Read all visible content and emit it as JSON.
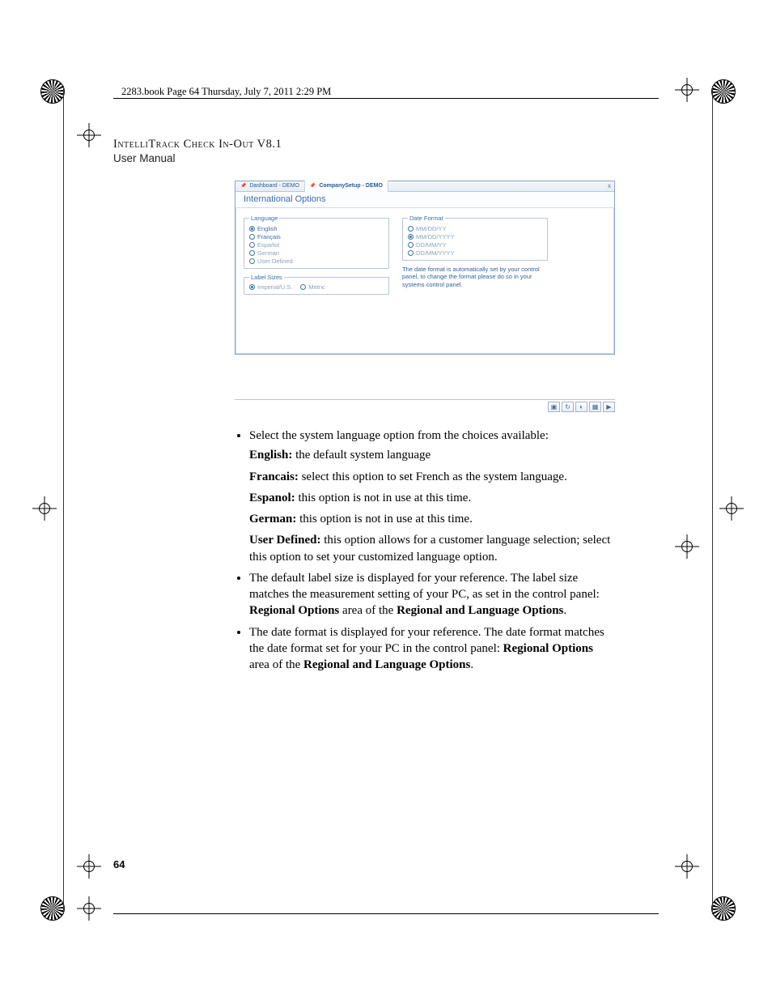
{
  "top_rule_text": "2283.book  Page 64  Thursday, July 7, 2011  2:29 PM",
  "header": {
    "title": "IntelliTrack Check In-Out V8.1",
    "subtitle": "User Manual"
  },
  "screenshot": {
    "tabs": [
      {
        "label": "Dashboard - DEMO",
        "active": false
      },
      {
        "label": "CompanySetup - DEMO",
        "active": true
      }
    ],
    "close_x": "x",
    "window_title": "International Options",
    "language": {
      "legend": "Language",
      "options": [
        {
          "label": "English",
          "selected": true,
          "dim": false
        },
        {
          "label": "Français",
          "selected": false,
          "dim": false
        },
        {
          "label": "Español",
          "selected": false,
          "dim": true
        },
        {
          "label": "German",
          "selected": false,
          "dim": true
        },
        {
          "label": "User Defined",
          "selected": false,
          "dim": true
        }
      ]
    },
    "label_sizes": {
      "legend": "Label Sizes",
      "options": [
        {
          "label": "Imperial/U.S.",
          "selected": true,
          "dim": true
        },
        {
          "label": "Metric",
          "selected": false,
          "dim": true
        }
      ]
    },
    "date_format": {
      "legend": "Date Format",
      "options": [
        {
          "label": "MM/DD/YY",
          "selected": false,
          "dim": true
        },
        {
          "label": "MM/DD/YYYY",
          "selected": true,
          "dim": true
        },
        {
          "label": "DD/MM/YY",
          "selected": false,
          "dim": true
        },
        {
          "label": "DD/MM/YYYY",
          "selected": false,
          "dim": true
        }
      ],
      "note": "The date format is automatically set by your control panel, to change the format please do so in  your systems control panel."
    },
    "footer_icons": [
      "save-icon",
      "refresh-icon",
      "globe-icon",
      "grid-icon",
      "play-icon"
    ],
    "footer_glyphs": [
      "▣",
      "↻",
      "◐",
      "▦",
      "▶"
    ]
  },
  "body": {
    "bullet1_intro": "Select the system language option from the choices available:",
    "lang_items": [
      {
        "b": "English:",
        "t": " the default system language"
      },
      {
        "b": "Francais:",
        "t": " select this option to set French as the system language."
      },
      {
        "b": "Espanol:",
        "t": " this option is not in use at this time."
      },
      {
        "b": "German:",
        "t": " this option is not in use at this time."
      },
      {
        "b": "User Defined:",
        "t": " this option allows for a customer language selection; select this option to set your customized language option."
      }
    ],
    "bullet2_a": "The default label size is displayed for your reference. The label size matches the measurement setting of your PC, as set in the control panel: ",
    "bullet2_b": "Regional Options",
    "bullet2_c": " area of the ",
    "bullet2_d": "Regional and Language Options",
    "bullet2_e": ".",
    "bullet3_a": "The date format is displayed for your reference. The date format matches the date format set for your PC in the control panel: ",
    "bullet3_b": "Regional Options",
    "bullet3_c": " area of the ",
    "bullet3_d": "Regional and Language Options",
    "bullet3_e": "."
  },
  "page_number": "64"
}
